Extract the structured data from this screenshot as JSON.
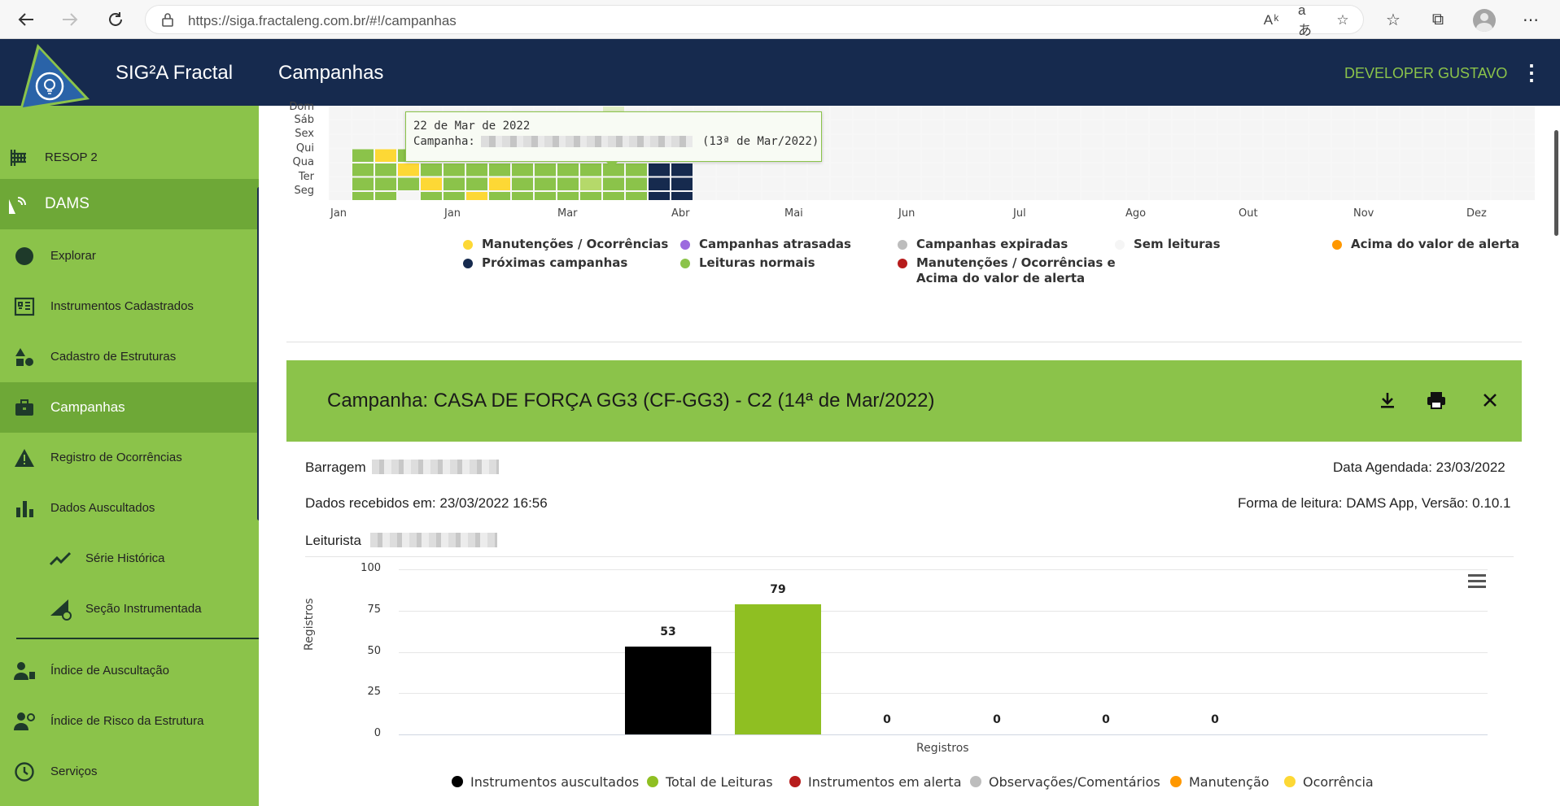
{
  "browser": {
    "url": "https://siga.fractaleng.com.br/#!/campanhas"
  },
  "header": {
    "app_title": "SIG²A Fractal",
    "page_title": "Campanhas",
    "user_name": "DEVELOPER GUSTAVO"
  },
  "sidebar": {
    "items": [
      {
        "label": "RESOP 2",
        "icon": "transmission-tower-icon"
      },
      {
        "label": "DAMS",
        "icon": "dam-icon"
      },
      {
        "label": "Explorar",
        "icon": "compass-icon"
      },
      {
        "label": "Instrumentos Cadastrados",
        "icon": "instruments-icon"
      },
      {
        "label": "Cadastro de Estruturas",
        "icon": "shapes-icon"
      },
      {
        "label": "Campanhas",
        "icon": "briefcase-icon"
      },
      {
        "label": "Registro de Ocorrências",
        "icon": "warning-icon"
      },
      {
        "label": "Dados Auscultados",
        "icon": "bar-chart-icon"
      },
      {
        "label": "Série Histórica",
        "icon": "line-chart-icon"
      },
      {
        "label": "Seção Instrumentada",
        "icon": "section-gear-icon"
      },
      {
        "label": "Índice de Auscultação",
        "icon": "worker-index-icon"
      },
      {
        "label": "Índice de Risco da Estrutura",
        "icon": "worker-risk-icon"
      },
      {
        "label": "Serviços",
        "icon": "clock-icon"
      }
    ]
  },
  "heatmap": {
    "days": [
      "Dom",
      "Sáb",
      "Sex",
      "Qui",
      "Qua",
      "Ter",
      "Seg"
    ],
    "months": [
      "Jan",
      "Jan",
      "Mar",
      "Abr",
      "Mai",
      "Jun",
      "Jul",
      "Ago",
      "Out",
      "Nov",
      "Dez"
    ],
    "tooltip": {
      "date": "22 de Mar de 2022",
      "campaign_label": "Campanha:",
      "campaign_when": "(13ª de Mar/2022)"
    },
    "legend": [
      {
        "label": "Manutenções / Ocorrências",
        "color": "#fdd835"
      },
      {
        "label": "Campanhas atrasadas",
        "color": "#9c6ade"
      },
      {
        "label": "Campanhas expiradas",
        "color": "#bdbdbd"
      },
      {
        "label": "Sem leituras",
        "color": "#f5f5f5"
      },
      {
        "label": "Acima do valor de alerta",
        "color": "#ff9800"
      },
      {
        "label": "Próximas campanhas",
        "color": "#162a4e"
      },
      {
        "label": "Leituras normais",
        "color": "#8bc34a"
      },
      {
        "label": "Manutenções / Ocorrências e",
        "label2": "Acima do valor de alerta",
        "color": "#b71c1c"
      }
    ]
  },
  "campaign": {
    "title": "Campanha: CASA DE FORÇA GG3 (CF-GG3) - C2 (14ª de Mar/2022)",
    "barragem_label": "Barragem",
    "data_agendada": "Data Agendada: 23/03/2022",
    "dados_recebidos": "Dados recebidos em: 23/03/2022 16:56",
    "forma_leitura": "Forma de leitura: DAMS App, Versão: 0.10.1",
    "leiturista_label": "Leiturista"
  },
  "chart_data": {
    "type": "bar",
    "categories": [
      "Registros"
    ],
    "xlabel": "Registros",
    "ylabel": "Registros",
    "ylim": [
      0,
      100
    ],
    "yticks": [
      0,
      25,
      50,
      75,
      100
    ],
    "grid": true,
    "legend_position": "bottom",
    "series": [
      {
        "name": "Instrumentos auscultados",
        "values": [
          53
        ],
        "color": "#000000"
      },
      {
        "name": "Total de Leituras",
        "values": [
          79
        ],
        "color": "#8fbf22"
      },
      {
        "name": "Instrumentos em alerta",
        "values": [
          0
        ],
        "color": "#b71c1c"
      },
      {
        "name": "Observações/Comentários",
        "values": [
          0
        ],
        "color": "#bdbdbd"
      },
      {
        "name": "Manutenção",
        "values": [
          0
        ],
        "color": "#ff9800"
      },
      {
        "name": "Ocorrência",
        "values": [
          0
        ],
        "color": "#fdd835"
      }
    ]
  }
}
